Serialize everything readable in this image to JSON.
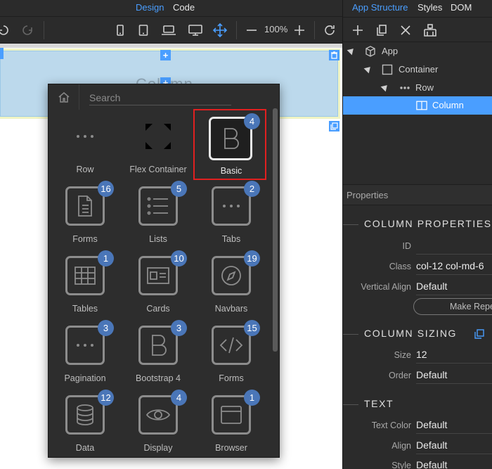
{
  "top_tabs": {
    "design": "Design",
    "code": "Code"
  },
  "toolbar": {
    "zoom": "100%"
  },
  "canvas": {
    "column_ghost_text": "Column"
  },
  "picker": {
    "search_placeholder": "Search",
    "tiles": [
      {
        "label": "Row",
        "badge": "",
        "icon": "dots-icon",
        "boxed": false
      },
      {
        "label": "Flex Container",
        "badge": "",
        "icon": "expand-arrows-icon",
        "boxed": false
      },
      {
        "label": "Basic",
        "badge": "4",
        "icon": "bootstrap-b-icon",
        "boxed": true,
        "selected": true
      },
      {
        "label": "Forms",
        "badge": "16",
        "icon": "document-icon",
        "boxed": true
      },
      {
        "label": "Lists",
        "badge": "5",
        "icon": "list-icon",
        "boxed": true
      },
      {
        "label": "Tabs",
        "badge": "2",
        "icon": "dots-icon",
        "boxed": true
      },
      {
        "label": "Tables",
        "badge": "1",
        "icon": "table-icon",
        "boxed": true
      },
      {
        "label": "Cards",
        "badge": "10",
        "icon": "id-card-icon",
        "boxed": true
      },
      {
        "label": "Navbars",
        "badge": "19",
        "icon": "compass-icon",
        "boxed": true
      },
      {
        "label": "Pagination",
        "badge": "3",
        "icon": "dots-icon",
        "boxed": true
      },
      {
        "label": "Bootstrap 4",
        "badge": "3",
        "icon": "bootstrap-b-icon",
        "boxed": true
      },
      {
        "label": "Forms",
        "badge": "15",
        "icon": "code-icon",
        "boxed": true
      },
      {
        "label": "Data",
        "badge": "12",
        "icon": "database-icon",
        "boxed": true
      },
      {
        "label": "Display",
        "badge": "4",
        "icon": "eye-icon",
        "boxed": true
      },
      {
        "label": "Browser",
        "badge": "1",
        "icon": "browser-window-icon",
        "boxed": true
      }
    ]
  },
  "right_tabs": {
    "app_structure": "App Structure",
    "styles": "Styles",
    "dom": "DOM"
  },
  "tree": [
    {
      "label": "App",
      "icon": "cube-icon"
    },
    {
      "label": "Container",
      "icon": "square-icon"
    },
    {
      "label": "Row",
      "icon": "dots-icon"
    },
    {
      "label": "Column",
      "icon": "column-icon",
      "selected": true
    }
  ],
  "properties": {
    "header": "Properties",
    "column_properties_title": "COLUMN PROPERTIES",
    "id_label": "ID",
    "id_value": "",
    "class_label": "Class",
    "class_value": "col-12 col-md-6",
    "valign_label": "Vertical Align",
    "valign_value": "Default",
    "make_repeat": "Make Repeat",
    "column_sizing_title": "COLUMN SIZING",
    "size_label": "Size",
    "size_value": "12",
    "order_label": "Order",
    "order_value": "Default",
    "text_title": "TEXT",
    "text_color_label": "Text Color",
    "text_color_value": "Default",
    "align_label": "Align",
    "align_value": "Default",
    "style_label": "Style",
    "style_value": "Default"
  },
  "colors": {
    "accent": "#4a9eff",
    "selection_frame": "#e02020",
    "badge": "#4a76b8"
  }
}
